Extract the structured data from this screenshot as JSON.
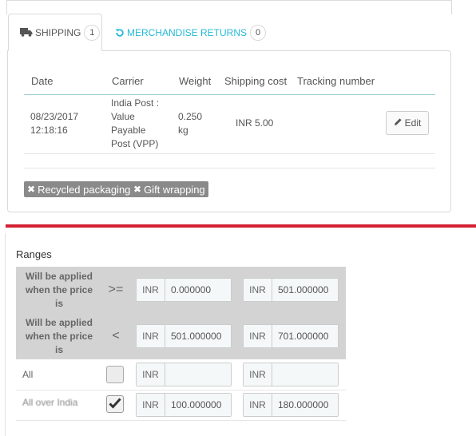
{
  "tabs": {
    "shipping": {
      "label": "SHIPPING",
      "count": "1"
    },
    "returns": {
      "label": "MERCHANDISE RETURNS",
      "count": "0"
    }
  },
  "shipping_table": {
    "headers": [
      "Date",
      "Carrier",
      "Weight",
      "Shipping cost",
      "Tracking number"
    ],
    "row": {
      "date_line1": "08/23/2017",
      "date_line2": "12:18:16",
      "carrier_lines": [
        "India Post :",
        "Value",
        "Payable",
        "Post (VPP)"
      ],
      "weight_line1": "0.250",
      "weight_line2": "kg",
      "cost": "INR 5.00",
      "tracking": "",
      "edit_label": "Edit"
    }
  },
  "tags": [
    "Recycled packaging",
    "Gift wrapping"
  ],
  "ranges": {
    "title": "Ranges",
    "band_label_lines": [
      "Will be applied",
      "when the price",
      "is"
    ],
    "rows": [
      {
        "operator": ">=",
        "currency1": "INR",
        "value1": "0.000000",
        "currency2": "INR",
        "value2": "501.000000"
      },
      {
        "operator": "<",
        "currency1": "INR",
        "value1": "501.000000",
        "currency2": "INR",
        "value2": "701.000000"
      }
    ],
    "all_row": {
      "label": "All",
      "checked": false,
      "currency1": "INR",
      "value1": "",
      "currency2": "INR",
      "value2": ""
    },
    "zone_row": {
      "label": "All over India",
      "checked": true,
      "currency1": "INR",
      "value1": "100.000000",
      "currency2": "INR",
      "value2": "180.000000"
    }
  },
  "colors": {
    "accent": "#25b9d7",
    "divider": "#d22030",
    "tag_bg": "#8a8a8a",
    "band_bg": "#d3d3d3"
  },
  "icons": [
    "truck-icon",
    "refresh-icon",
    "pencil-icon",
    "remove-icon",
    "checkmark-icon"
  ]
}
